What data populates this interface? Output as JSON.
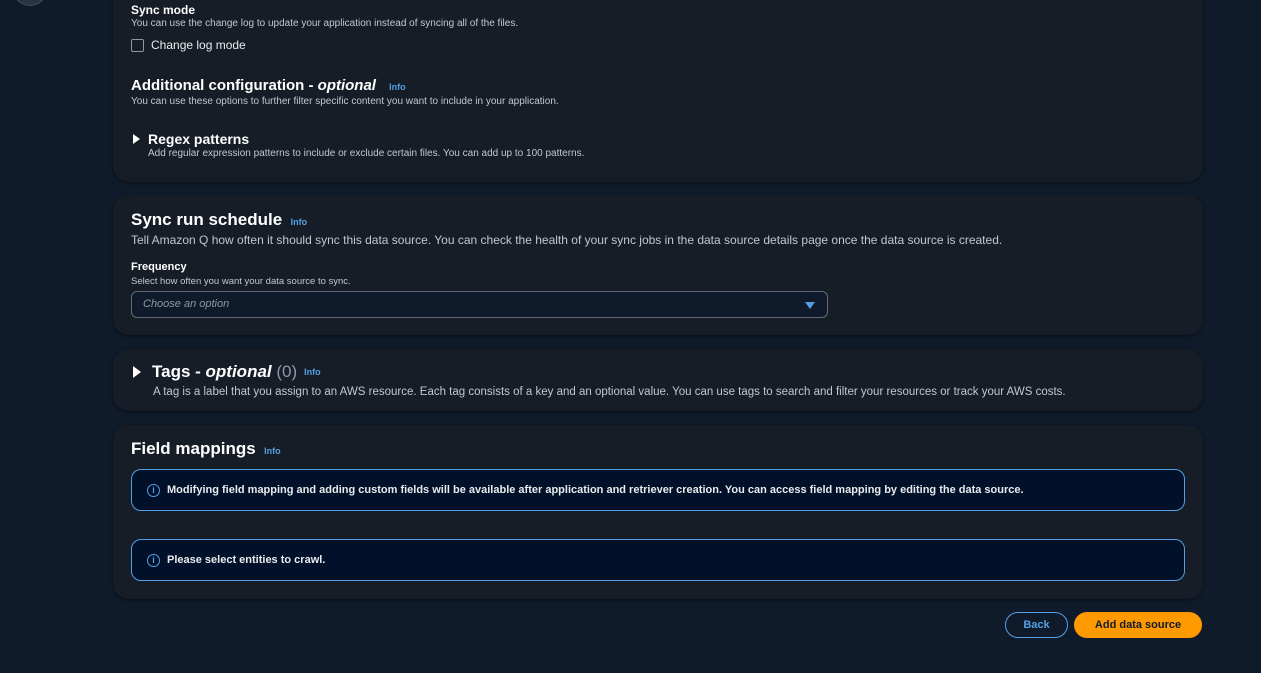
{
  "sync_mode": {
    "label": "Sync mode",
    "description": "You can use the change log to update your application instead of syncing all of the files.",
    "checkbox_label": "Change log mode",
    "checked": false
  },
  "additional_config": {
    "title": "Additional configuration - ",
    "title_optional": "optional",
    "info": "Info",
    "description": "You can use these options to further filter specific content you want to include in your application.",
    "regex": {
      "title": "Regex patterns",
      "description": "Add regular expression patterns to include or exclude certain files. You can add up to 100 patterns."
    }
  },
  "sync_schedule": {
    "title": "Sync run schedule",
    "info": "Info",
    "description": "Tell Amazon Q how often it should sync this data source. You can check the health of your sync jobs in the data source details page once the data source is created.",
    "frequency_label": "Frequency",
    "frequency_description": "Select how often you want your data source to sync.",
    "frequency_placeholder": "Choose an option"
  },
  "tags": {
    "title": "Tags - ",
    "title_optional": "optional",
    "count": "(0)",
    "info": "Info",
    "description": "A tag is a label that you assign to an AWS resource. Each tag consists of a key and an optional value. You can use tags to search and filter your resources or track your AWS costs."
  },
  "field_mappings": {
    "title": "Field mappings",
    "info": "Info",
    "alerts": [
      "Modifying field mapping and adding custom fields will be available after application and retriever creation. You can access field mapping by editing the data source.",
      "Please select entities to crawl."
    ]
  },
  "footer": {
    "back_label": "Back",
    "add_label": "Add data source"
  },
  "colors": {
    "background": "#0f1b2a",
    "card": "#161d26",
    "accent": "#539fe5",
    "primary": "#ff9900"
  },
  "icons": [
    "triangle-right-icon",
    "chevron-down-icon",
    "info-circle-icon"
  ]
}
